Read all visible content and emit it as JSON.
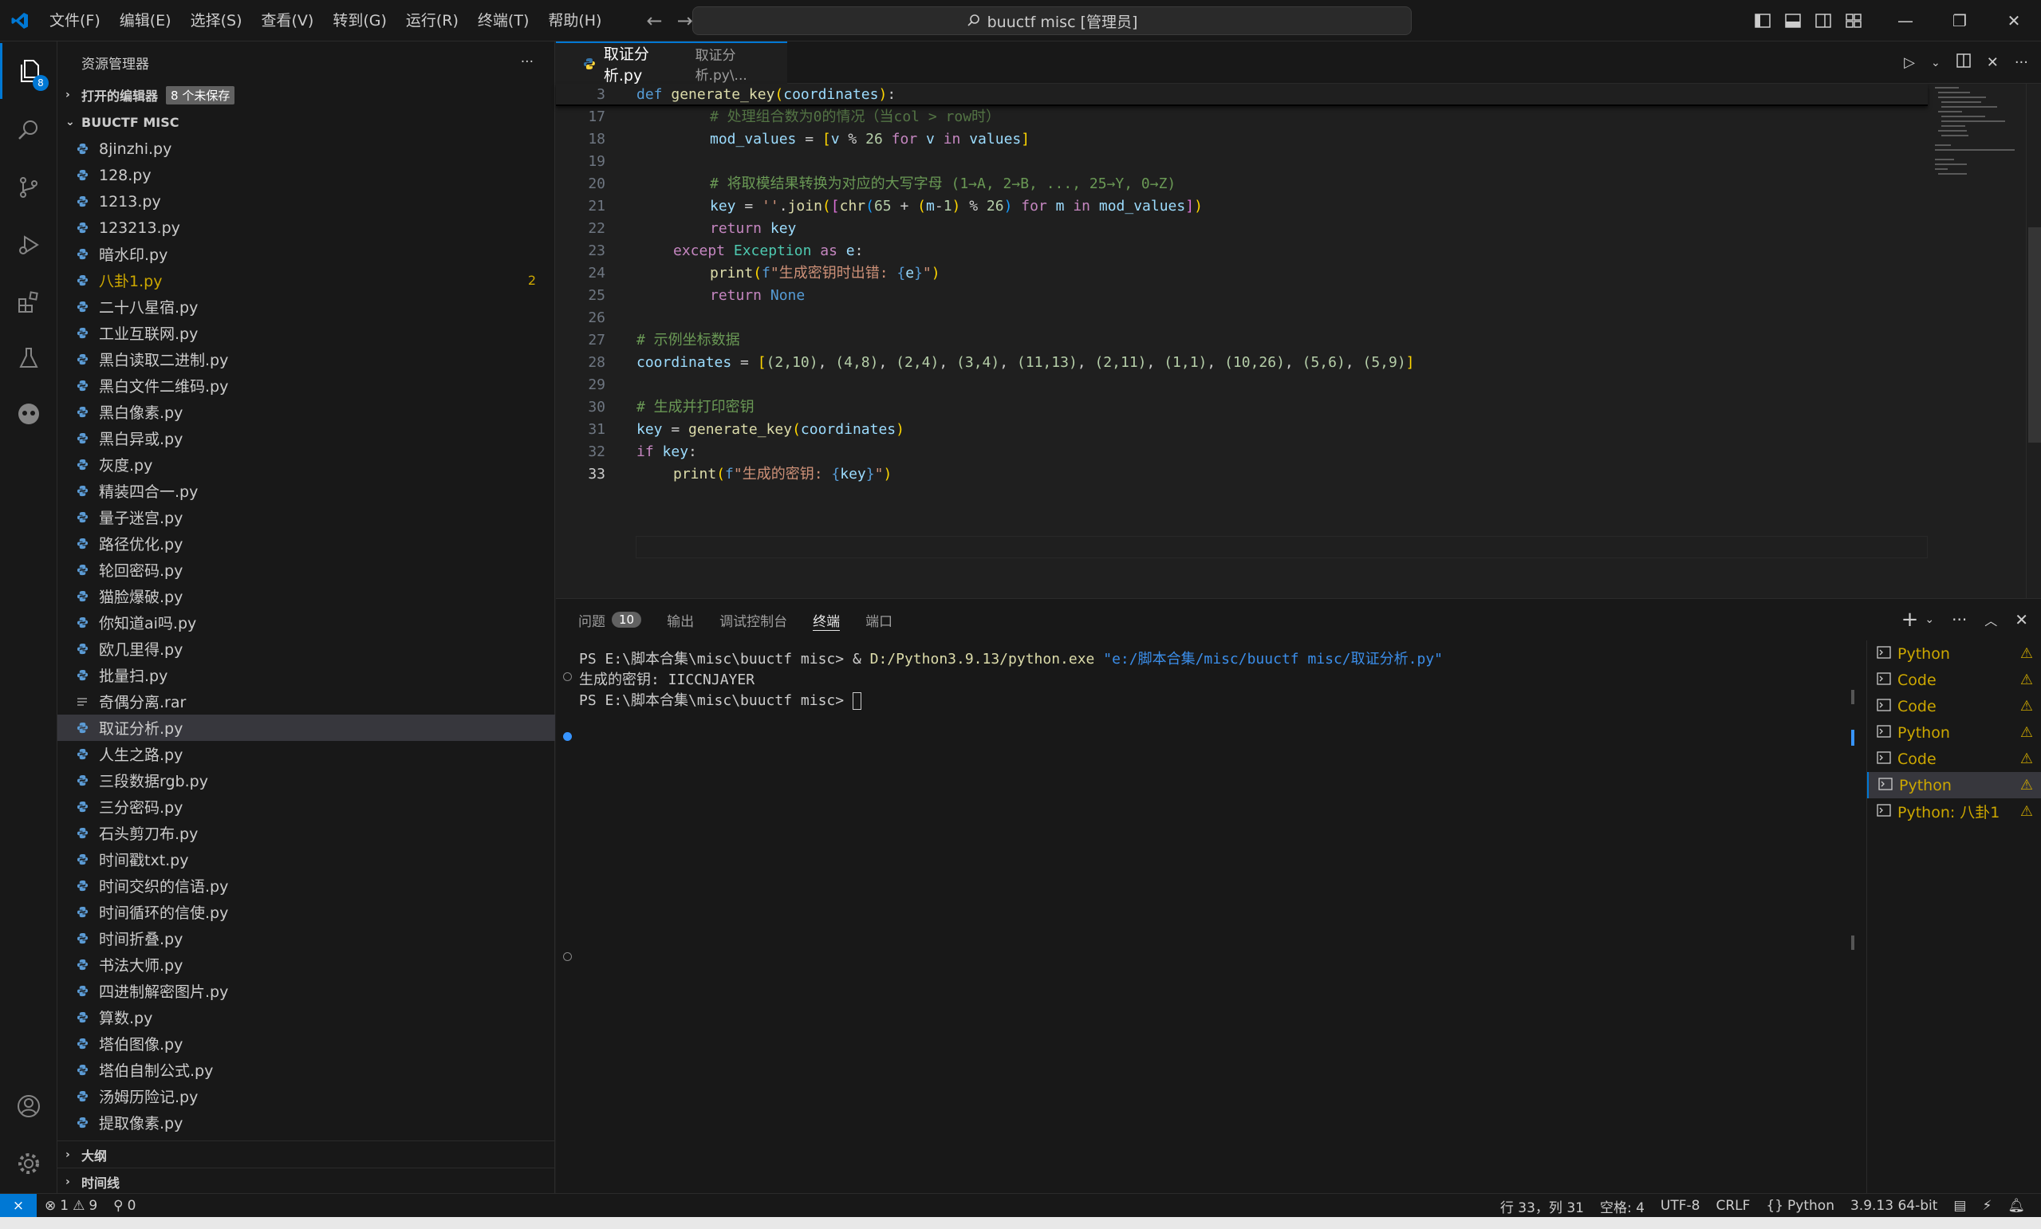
{
  "titlebar": {
    "menus": [
      "文件(F)",
      "编辑(E)",
      "选择(S)",
      "查看(V)",
      "转到(G)",
      "运行(R)",
      "终端(T)",
      "帮助(H)"
    ],
    "command_center": "buuctf misc [管理员]"
  },
  "activitybar": {
    "explorer_badge": "8"
  },
  "sidebar": {
    "title": "资源管理器",
    "open_editors": "打开的编辑器",
    "unsaved": "8 个未保存",
    "folder": "BUUCTF MISC",
    "files": [
      {
        "name": "8jinzhi.py"
      },
      {
        "name": "128.py"
      },
      {
        "name": "1213.py"
      },
      {
        "name": "123213.py"
      },
      {
        "name": "暗水印.py"
      },
      {
        "name": "八卦1.py",
        "badge": "2"
      },
      {
        "name": "二十八星宿.py"
      },
      {
        "name": "工业互联网.py"
      },
      {
        "name": "黑白读取二进制.py"
      },
      {
        "name": "黑白文件二维码.py"
      },
      {
        "name": "黑白像素.py"
      },
      {
        "name": "黑白异或.py"
      },
      {
        "name": "灰度.py"
      },
      {
        "name": "精装四合一.py"
      },
      {
        "name": "量子迷宫.py"
      },
      {
        "name": "路径优化.py"
      },
      {
        "name": "轮回密码.py"
      },
      {
        "name": "猫脸爆破.py"
      },
      {
        "name": "你知道ai吗.py"
      },
      {
        "name": "欧几里得.py"
      },
      {
        "name": "批量扫.py"
      },
      {
        "name": "奇偶分离.rar"
      },
      {
        "name": "取证分析.py"
      },
      {
        "name": "人生之路.py"
      },
      {
        "name": "三段数据rgb.py"
      },
      {
        "name": "三分密码.py"
      },
      {
        "name": "石头剪刀布.py"
      },
      {
        "name": "时间戳txt.py"
      },
      {
        "name": "时间交织的信语.py"
      },
      {
        "name": "时间循环的信使.py"
      },
      {
        "name": "时间折叠.py"
      },
      {
        "name": "书法大师.py"
      },
      {
        "name": "四进制解密图片.py"
      },
      {
        "name": "算数.py"
      },
      {
        "name": "塔伯图像.py"
      },
      {
        "name": "塔伯自制公式.py"
      },
      {
        "name": "汤姆历险记.py"
      },
      {
        "name": "提取像素.py"
      }
    ],
    "outline": "大纲",
    "timeline": "时间线"
  },
  "editor": {
    "tab_name": "取证分析.py",
    "tab_path": "取证分析.py\\...",
    "lines": [
      "3",
      "17",
      "18",
      "19",
      "20",
      "21",
      "22",
      "23",
      "24",
      "25",
      "26",
      "27",
      "28",
      "29",
      "30",
      "31",
      "32",
      "33"
    ],
    "code": {
      "l3": {
        "kw": "def",
        "fn": "generate_key",
        "arg": "coordinates"
      },
      "l17": "# 处理组合数为0的情况（当col > row时）",
      "l18": {
        "var": "mod_values",
        "v": "v",
        "op": "%",
        "num": "26",
        "for": "for",
        "in": "in",
        "iter": "values"
      },
      "l20": "# 将取模结果转换为对应的大写字母 (1→A, 2→B, ..., 25→Y, 0→Z)",
      "l21": {
        "var": "key",
        "str": "''",
        "join": "join",
        "chr": "chr",
        "n65": "65",
        "m": "m",
        "n1": "1",
        "n26": "26",
        "for": "for",
        "in": "in",
        "iter": "mod_values"
      },
      "l22": {
        "kw": "return",
        "var": "key"
      },
      "l23": {
        "kw": "except",
        "cls": "Exception",
        "as": "as",
        "e": "e"
      },
      "l24": {
        "fn": "print",
        "f": "f",
        "str": "\"生成密钥时出错: ",
        "e": "e",
        "end": "\""
      },
      "l25": {
        "kw": "return",
        "none": "None"
      },
      "l27": "# 示例坐标数据",
      "l28": {
        "var": "coordinates",
        "pairs": [
          "(2,10)",
          "(4,8)",
          "(2,4)",
          "(3,4)",
          "(11,13)",
          "(2,11)",
          "(1,1)",
          "(10,26)",
          "(5,6)",
          "(5,9)"
        ]
      },
      "l30": "# 生成并打印密钥",
      "l31": {
        "var": "key",
        "fn": "generate_key",
        "arg": "coordinates"
      },
      "l32": {
        "kw": "if",
        "var": "key"
      },
      "l33": {
        "fn": "print",
        "f": "f",
        "str": "\"生成的密钥: ",
        "var": "key",
        "end": "\""
      }
    }
  },
  "panel": {
    "tabs": [
      {
        "label": "问题",
        "count": "10"
      },
      {
        "label": "输出"
      },
      {
        "label": "调试控制台"
      },
      {
        "label": "终端"
      },
      {
        "label": "端口"
      }
    ],
    "terminal": {
      "prompt1": "PS E:\\脚本合集\\misc\\buuctf misc> ",
      "amp": "& ",
      "exe": "D:/Python3.9.13/python.exe",
      "arg": " \"e:/脚本合集/misc/buuctf misc/取证分析.py\"",
      "output": "生成的密钥: IICCNJAYER",
      "prompt2": "PS E:\\脚本合集\\misc\\buuctf misc> "
    },
    "terminals": [
      "Python",
      "Code",
      "Code",
      "Python",
      "Code",
      "Python",
      "Python: 八卦1"
    ]
  },
  "statusbar": {
    "errors": "1",
    "warnings": "9",
    "ports": "0",
    "position": "行 33，列 31",
    "spaces": "空格: 4",
    "encoding": "UTF-8",
    "eol": "CRLF",
    "language": "Python",
    "interpreter": "3.9.13 64-bit"
  },
  "colors": {
    "accent": "#0078d4",
    "warning": "#cca700",
    "background": "#1f1f1f",
    "sidebar": "#181818"
  }
}
